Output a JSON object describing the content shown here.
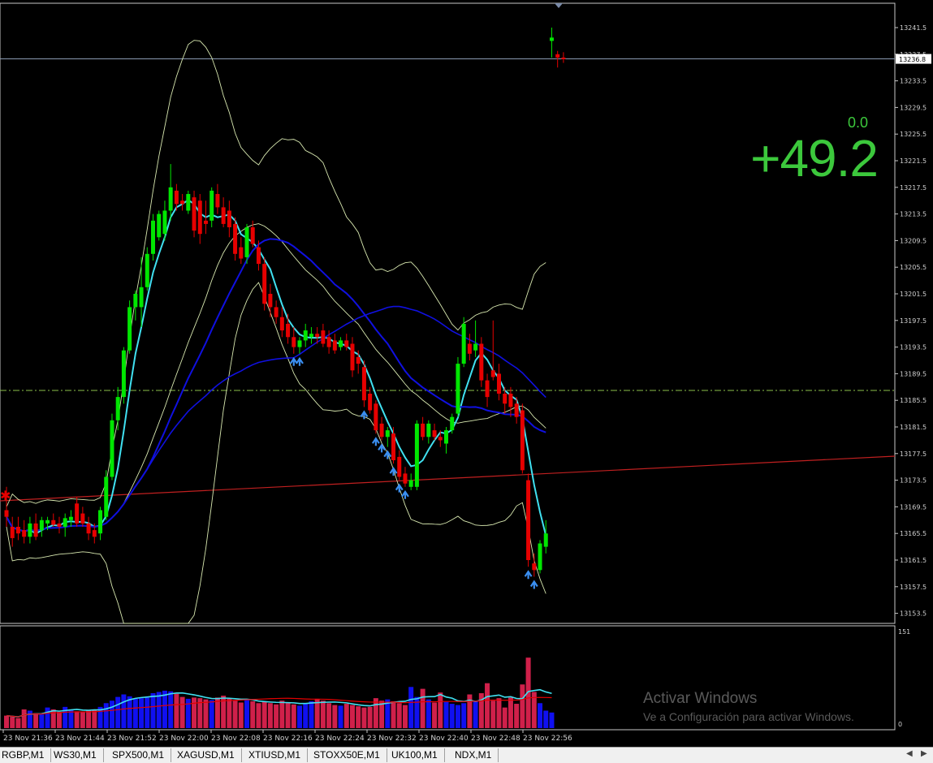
{
  "price_axis": {
    "labels": [
      "13241.5",
      "13237.5",
      "13233.5",
      "13229.5",
      "13225.5",
      "13221.5",
      "13217.5",
      "13213.5",
      "13209.5",
      "13205.5",
      "13201.5",
      "13197.5",
      "13193.5",
      "13189.5",
      "13185.5",
      "13181.5",
      "13177.5",
      "13173.5",
      "13169.5",
      "13165.5",
      "13161.5",
      "13157.5",
      "13153.5"
    ],
    "current_price": "13236.8"
  },
  "time_axis": {
    "labels": [
      "23 Nov 21:36",
      "23 Nov 21:44",
      "23 Nov 21:52",
      "23 Nov 22:00",
      "23 Nov 22:08",
      "23 Nov 22:16",
      "23 Nov 22:24",
      "23 Nov 22:32",
      "23 Nov 22:40",
      "23 Nov 22:48",
      "23 Nov 22:56"
    ]
  },
  "indicator_panel": {
    "max_label": "151",
    "min_label": "0"
  },
  "overlay": {
    "big_value": "+49.2",
    "small_value": "0.0"
  },
  "watermark": {
    "title": "Activar Windows",
    "subtitle": "Ve a Configuración para activar Windows."
  },
  "symbol_tabs": [
    "RGBP,M1",
    "WS30,M1",
    "SPX500,M1",
    "XAGUSD,M1",
    "XTIUSD,M1",
    "STOXX50E,M1",
    "UK100,M1",
    "NDX,M1"
  ],
  "colors": {
    "bull": "#00e600",
    "bear": "#e60000",
    "ma_fast": "#40e0f0",
    "ma_slow": "#1010e0",
    "trend": "#c02020",
    "bands": "#d8e8b0",
    "volume_up": "#1010f0",
    "volume_down": "#d0204a"
  },
  "chart_data": {
    "type": "candlestick",
    "symbol_timeframe": "M1",
    "ylim": [
      13152.5,
      13244.5
    ],
    "candles": [
      {
        "o": 13169.0,
        "h": 13172.5,
        "l": 13166.5,
        "c": 13168.0
      },
      {
        "o": 13166.5,
        "h": 13168.0,
        "l": 13163.5,
        "c": 13164.8
      },
      {
        "o": 13166.5,
        "h": 13168.0,
        "l": 13164.5,
        "c": 13165.5
      },
      {
        "o": 13166.0,
        "h": 13167.5,
        "l": 13164.0,
        "c": 13165.0
      },
      {
        "o": 13165.0,
        "h": 13168.0,
        "l": 13164.0,
        "c": 13167.0
      },
      {
        "o": 13167.0,
        "h": 13168.5,
        "l": 13164.5,
        "c": 13165.0
      },
      {
        "o": 13166.0,
        "h": 13168.0,
        "l": 13165.0,
        "c": 13167.5
      },
      {
        "o": 13167.0,
        "h": 13168.0,
        "l": 13166.0,
        "c": 13167.5
      },
      {
        "o": 13167.5,
        "h": 13168.5,
        "l": 13166.5,
        "c": 13166.8
      },
      {
        "o": 13167.0,
        "h": 13168.0,
        "l": 13165.5,
        "c": 13166.5
      },
      {
        "o": 13166.5,
        "h": 13168.5,
        "l": 13165.0,
        "c": 13167.8
      },
      {
        "o": 13167.5,
        "h": 13169.0,
        "l": 13166.5,
        "c": 13168.0
      },
      {
        "o": 13170.0,
        "h": 13171.0,
        "l": 13166.5,
        "c": 13167.0
      },
      {
        "o": 13168.5,
        "h": 13169.5,
        "l": 13166.5,
        "c": 13167.0
      },
      {
        "o": 13167.0,
        "h": 13168.0,
        "l": 13164.5,
        "c": 13165.5
      },
      {
        "o": 13166.0,
        "h": 13167.0,
        "l": 13164.0,
        "c": 13165.0
      },
      {
        "o": 13165.5,
        "h": 13169.5,
        "l": 13164.5,
        "c": 13169.0
      },
      {
        "o": 13168.0,
        "h": 13175.0,
        "l": 13167.5,
        "c": 13174.0
      },
      {
        "o": 13174.0,
        "h": 13183.5,
        "l": 13173.5,
        "c": 13182.5
      },
      {
        "o": 13182.5,
        "h": 13187.5,
        "l": 13181.0,
        "c": 13186.0
      },
      {
        "o": 13186.0,
        "h": 13193.5,
        "l": 13185.0,
        "c": 13193.0
      },
      {
        "o": 13193.0,
        "h": 13200.5,
        "l": 13192.5,
        "c": 13199.5
      },
      {
        "o": 13199.5,
        "h": 13202.0,
        "l": 13197.5,
        "c": 13201.5
      },
      {
        "o": 13199.5,
        "h": 13207.0,
        "l": 13196.5,
        "c": 13202.5
      },
      {
        "o": 13202.5,
        "h": 13208.5,
        "l": 13202.0,
        "c": 13207.5
      },
      {
        "o": 13207.5,
        "h": 13213.5,
        "l": 13206.5,
        "c": 13212.5
      },
      {
        "o": 13210.0,
        "h": 13214.0,
        "l": 13209.5,
        "c": 13213.5
      },
      {
        "o": 13210.5,
        "h": 13215.5,
        "l": 13209.5,
        "c": 13214.0
      },
      {
        "o": 13214.0,
        "h": 13221.0,
        "l": 13212.5,
        "c": 13217.5
      },
      {
        "o": 13217.0,
        "h": 13218.0,
        "l": 13214.0,
        "c": 13215.0
      },
      {
        "o": 13215.5,
        "h": 13216.5,
        "l": 13214.0,
        "c": 13215.0
      },
      {
        "o": 13214.0,
        "h": 13217.0,
        "l": 13213.5,
        "c": 13216.5
      },
      {
        "o": 13216.0,
        "h": 13217.0,
        "l": 13210.0,
        "c": 13211.0
      },
      {
        "o": 13215.5,
        "h": 13216.5,
        "l": 13209.0,
        "c": 13210.5
      },
      {
        "o": 13212.5,
        "h": 13215.5,
        "l": 13210.5,
        "c": 13212.0
      },
      {
        "o": 13212.5,
        "h": 13217.5,
        "l": 13211.5,
        "c": 13217.0
      },
      {
        "o": 13216.5,
        "h": 13218.0,
        "l": 13213.5,
        "c": 13214.5
      },
      {
        "o": 13214.5,
        "h": 13216.0,
        "l": 13211.5,
        "c": 13212.0
      },
      {
        "o": 13214.0,
        "h": 13215.5,
        "l": 13210.0,
        "c": 13211.5
      },
      {
        "o": 13212.0,
        "h": 13213.0,
        "l": 13206.5,
        "c": 13207.5
      },
      {
        "o": 13208.5,
        "h": 13210.0,
        "l": 13206.0,
        "c": 13206.8
      },
      {
        "o": 13207.0,
        "h": 13212.0,
        "l": 13206.0,
        "c": 13211.5
      },
      {
        "o": 13211.5,
        "h": 13212.5,
        "l": 13208.5,
        "c": 13209.0
      },
      {
        "o": 13208.5,
        "h": 13209.5,
        "l": 13205.0,
        "c": 13206.0
      },
      {
        "o": 13206.0,
        "h": 13207.0,
        "l": 13199.0,
        "c": 13200.0
      },
      {
        "o": 13201.5,
        "h": 13203.0,
        "l": 13198.0,
        "c": 13199.5
      },
      {
        "o": 13199.5,
        "h": 13200.5,
        "l": 13197.0,
        "c": 13198.0
      },
      {
        "o": 13198.0,
        "h": 13199.5,
        "l": 13195.0,
        "c": 13196.0
      },
      {
        "o": 13197.0,
        "h": 13198.5,
        "l": 13194.0,
        "c": 13195.0
      },
      {
        "o": 13195.0,
        "h": 13196.5,
        "l": 13192.5,
        "c": 13193.5
      },
      {
        "o": 13193.5,
        "h": 13195.0,
        "l": 13192.5,
        "c": 13194.5
      },
      {
        "o": 13194.5,
        "h": 13197.0,
        "l": 13193.5,
        "c": 13196.0
      },
      {
        "o": 13195.0,
        "h": 13196.5,
        "l": 13194.0,
        "c": 13195.5
      },
      {
        "o": 13195.5,
        "h": 13196.5,
        "l": 13194.0,
        "c": 13195.0
      },
      {
        "o": 13196.0,
        "h": 13197.0,
        "l": 13193.5,
        "c": 13194.0
      },
      {
        "o": 13195.0,
        "h": 13196.0,
        "l": 13192.5,
        "c": 13193.5
      },
      {
        "o": 13194.5,
        "h": 13195.5,
        "l": 13192.5,
        "c": 13193.0
      },
      {
        "o": 13193.5,
        "h": 13195.0,
        "l": 13193.0,
        "c": 13194.5
      },
      {
        "o": 13194.5,
        "h": 13195.5,
        "l": 13193.0,
        "c": 13193.5
      },
      {
        "o": 13194.0,
        "h": 13195.0,
        "l": 13189.0,
        "c": 13190.0
      },
      {
        "o": 13192.0,
        "h": 13193.0,
        "l": 13189.5,
        "c": 13191.0
      },
      {
        "o": 13190.5,
        "h": 13191.5,
        "l": 13184.5,
        "c": 13185.5
      },
      {
        "o": 13186.5,
        "h": 13187.5,
        "l": 13183.5,
        "c": 13184.0
      },
      {
        "o": 13185.0,
        "h": 13185.5,
        "l": 13180.5,
        "c": 13181.0
      },
      {
        "o": 13182.0,
        "h": 13183.0,
        "l": 13179.5,
        "c": 13180.0
      },
      {
        "o": 13180.0,
        "h": 13181.5,
        "l": 13178.5,
        "c": 13181.0
      },
      {
        "o": 13180.5,
        "h": 13181.5,
        "l": 13176.0,
        "c": 13176.5
      },
      {
        "o": 13177.0,
        "h": 13178.0,
        "l": 13173.5,
        "c": 13174.0
      },
      {
        "o": 13174.5,
        "h": 13175.5,
        "l": 13172.5,
        "c": 13173.0
      },
      {
        "o": 13172.5,
        "h": 13174.5,
        "l": 13172.0,
        "c": 13173.5
      },
      {
        "o": 13172.5,
        "h": 13182.5,
        "l": 13172.0,
        "c": 13182.0
      },
      {
        "o": 13182.0,
        "h": 13183.0,
        "l": 13179.5,
        "c": 13180.0
      },
      {
        "o": 13180.0,
        "h": 13182.5,
        "l": 13179.0,
        "c": 13182.0
      },
      {
        "o": 13181.0,
        "h": 13182.0,
        "l": 13179.5,
        "c": 13180.0
      },
      {
        "o": 13180.0,
        "h": 13181.0,
        "l": 13178.5,
        "c": 13179.5
      },
      {
        "o": 13179.0,
        "h": 13181.5,
        "l": 13177.5,
        "c": 13181.0
      },
      {
        "o": 13181.0,
        "h": 13183.5,
        "l": 13180.5,
        "c": 13183.0
      },
      {
        "o": 13183.5,
        "h": 13192.0,
        "l": 13183.0,
        "c": 13191.0
      },
      {
        "o": 13191.0,
        "h": 13198.0,
        "l": 13190.5,
        "c": 13197.0
      },
      {
        "o": 13194.0,
        "h": 13195.5,
        "l": 13191.5,
        "c": 13192.5
      },
      {
        "o": 13193.0,
        "h": 13197.5,
        "l": 13192.0,
        "c": 13194.0
      },
      {
        "o": 13194.0,
        "h": 13195.0,
        "l": 13187.5,
        "c": 13188.5
      },
      {
        "o": 13188.5,
        "h": 13189.5,
        "l": 13184.5,
        "c": 13186.0
      },
      {
        "o": 13190.0,
        "h": 13197.5,
        "l": 13188.5,
        "c": 13189.0
      },
      {
        "o": 13189.5,
        "h": 13191.0,
        "l": 13185.5,
        "c": 13186.5
      },
      {
        "o": 13186.5,
        "h": 13187.5,
        "l": 13183.5,
        "c": 13185.0
      },
      {
        "o": 13186.5,
        "h": 13187.5,
        "l": 13183.0,
        "c": 13184.5
      },
      {
        "o": 13185.0,
        "h": 13186.0,
        "l": 13182.0,
        "c": 13183.0
      },
      {
        "o": 13184.0,
        "h": 13185.0,
        "l": 13174.5,
        "c": 13175.0
      },
      {
        "o": 13173.5,
        "h": 13174.5,
        "l": 13160.5,
        "c": 13161.5
      },
      {
        "o": 13161.0,
        "h": 13162.5,
        "l": 13159.0,
        "c": 13160.0
      },
      {
        "o": 13160.0,
        "h": 13164.5,
        "l": 13159.5,
        "c": 13164.0
      },
      {
        "o": 13163.5,
        "h": 13167.5,
        "l": 13162.5,
        "c": 13165.5
      },
      {
        "o": 13239.5,
        "h": 13241.5,
        "l": 13237.0,
        "c": 13240.0
      },
      {
        "o": 13237.5,
        "h": 13238.0,
        "l": 13235.5,
        "c": 13237.0
      },
      {
        "o": 13237.0,
        "h": 13237.8,
        "l": 13236.2,
        "c": 13236.8
      }
    ],
    "signal_arrows_at_index": [
      49,
      50,
      61,
      63,
      64,
      65,
      66,
      67,
      68,
      89,
      90
    ],
    "volume": [
      20,
      18,
      16,
      30,
      28,
      24,
      22,
      33,
      30,
      26,
      34,
      30,
      27,
      26,
      28,
      30,
      34,
      40,
      44,
      50,
      54,
      51,
      47,
      48,
      49,
      56,
      58,
      60,
      59,
      55,
      50,
      47,
      49,
      48,
      46,
      45,
      49,
      52,
      47,
      44,
      41,
      45,
      43,
      40,
      42,
      40,
      38,
      44,
      41,
      38,
      36,
      40,
      43,
      47,
      44,
      40,
      37,
      36,
      39,
      37,
      35,
      33,
      34,
      48,
      44,
      46,
      43,
      40,
      37,
      66,
      50,
      63,
      46,
      41,
      57,
      42,
      39,
      37,
      40,
      54,
      44,
      56,
      72,
      44,
      48,
      33,
      49,
      39,
      70,
      113,
      58,
      40,
      28,
      25
    ]
  }
}
